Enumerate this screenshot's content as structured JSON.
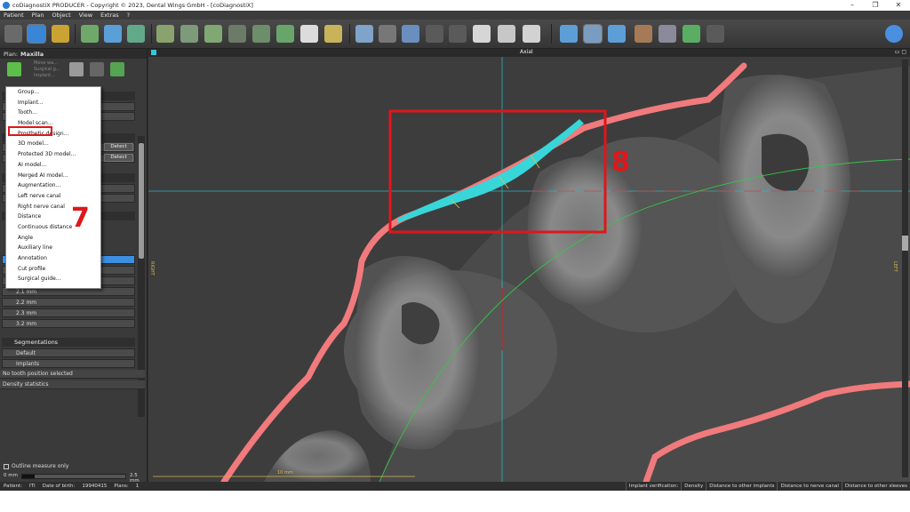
{
  "window": {
    "title": "coDiagnostiX PRODUCER - Copyright © 2023, Dental Wings GmbH - [coDiagnostiX]",
    "controls": [
      "–",
      "❐",
      "✕"
    ]
  },
  "menu": [
    "Patient",
    "Plan",
    "Object",
    "View",
    "Extras",
    "?"
  ],
  "plan": {
    "label": "Plan:",
    "name": "Maxilla"
  },
  "plan_tools_hidden_text": [
    "Move wa...",
    "Surgical g...",
    "Implant..."
  ],
  "dropdown": {
    "items": [
      "Group...",
      "Implant...",
      "Tooth...",
      "Model scan...",
      "Prosthetic design...",
      "3D model...",
      "Protected 3D model...",
      "AI model...",
      "Merged AI model...",
      "Augmentation...",
      "Left nerve canal",
      "Right nerve canal",
      "Distance",
      "Continuous distance",
      "Angle",
      "Auxiliary line",
      "Annotation",
      "Cut profile",
      "Surgical guide..."
    ],
    "highlighted": "Distance"
  },
  "detect_label": "Detect",
  "distance_items": [
    "2.1 mm",
    "2.2 mm",
    "2.3 mm",
    "3.2 mm"
  ],
  "segmentations": {
    "header": "Segmentations",
    "items": [
      "Default",
      "Implants"
    ]
  },
  "rows": {
    "tooth_position": "No tooth position selected",
    "density": "Density statistics"
  },
  "outline": {
    "label": "Outline measure only",
    "min": "0 mm",
    "max": "2.5 mm"
  },
  "viewer": {
    "title": "Axial",
    "left_label": "RIGHT",
    "right_label": "LEFT",
    "scale_label": "10 mm"
  },
  "annotations": {
    "step7": "7",
    "step8": "8"
  },
  "status": {
    "patient_label": "Patient:",
    "patient": "ITI",
    "dob_label": "Date of birth:",
    "dob": "19940415",
    "plans_label": "Plans:",
    "plans": "1",
    "implant_verification": "Implant verification:",
    "tabs": [
      "Density",
      "Distance to other implants",
      "Distance to nerve canal",
      "Distance to other sleeves"
    ]
  },
  "colors": {
    "highlight_red": "#e0161b",
    "cyan_measure": "#38d6d9",
    "soft_tissue_line": "#f17a7c",
    "arch_green": "#36c44a"
  }
}
